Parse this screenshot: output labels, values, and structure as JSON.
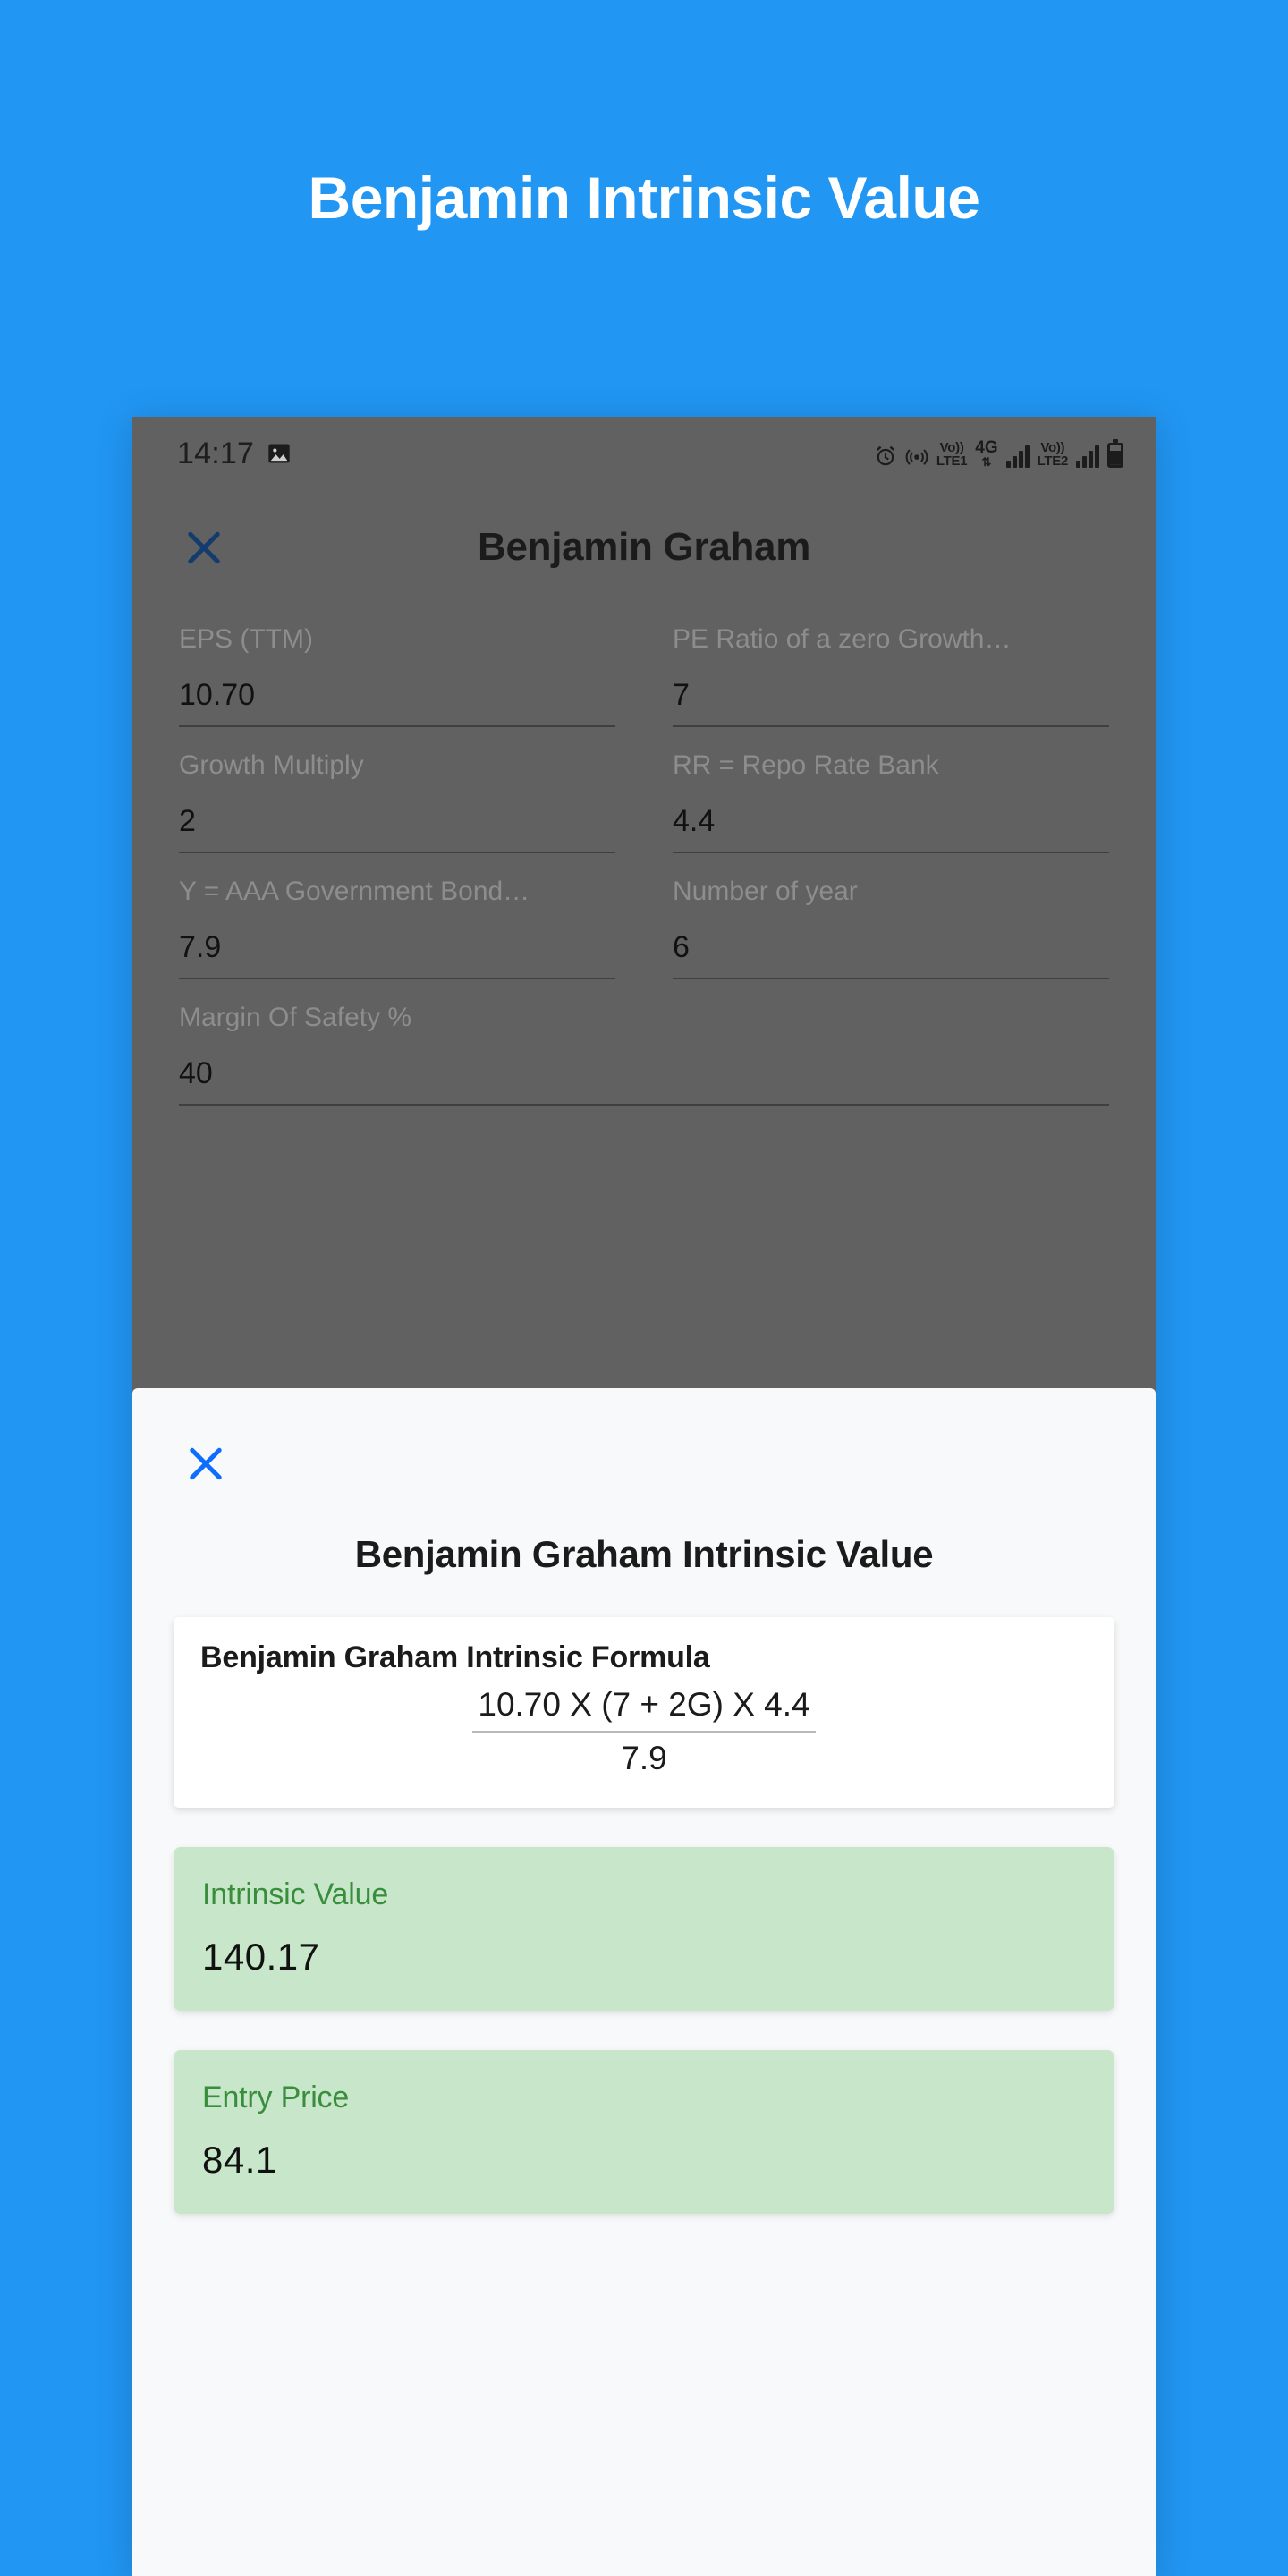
{
  "hero": {
    "title": "Benjamin Intrinsic Value",
    "background_color": "#2196f3"
  },
  "phone": {
    "statusbar": {
      "time": "14:17",
      "left_icons": [
        "image-icon"
      ],
      "right_icons": [
        "alarm-icon",
        "hotspot-icon",
        "volte1-icon",
        "4g-lte-icon",
        "signal-bars-icon",
        "volte2-icon",
        "signal-bars-icon",
        "battery-icon"
      ],
      "volte1_top": "Vo))",
      "volte1_bottom": "LTE1",
      "network_top": "4G",
      "network_bottom": "⇅",
      "volte2_top": "Vo))",
      "volte2_bottom": "LTE2"
    },
    "appbar": {
      "close_label": "×",
      "title": "Benjamin Graham"
    },
    "form": {
      "fields": [
        {
          "label": "EPS (TTM)",
          "value": "10.70"
        },
        {
          "label": "PE Ratio of a zero Growth…",
          "value": "7"
        },
        {
          "label": "Growth Multiply",
          "value": "2"
        },
        {
          "label": "RR = Repo Rate Bank",
          "value": "4.4"
        },
        {
          "label": "Y = AAA Government Bond…",
          "value": "7.9"
        },
        {
          "label": "Number of year",
          "value": "6"
        },
        {
          "label": "Margin Of Safety %",
          "value": "40"
        }
      ]
    },
    "sheet": {
      "close_label": "×",
      "title": "Benjamin Graham Intrinsic Value",
      "formula": {
        "heading": "Benjamin Graham Intrinsic Formula",
        "numerator": "10.70 X (7 + 2G) X 4.4",
        "denominator": "7.9"
      },
      "results": [
        {
          "label": "Intrinsic Value",
          "value": "140.17",
          "bg": "#c8e6c9",
          "label_color": "#388e3c"
        },
        {
          "label": "Entry Price",
          "value": "84.1",
          "bg": "#c8e6c9",
          "label_color": "#388e3c"
        }
      ]
    }
  }
}
